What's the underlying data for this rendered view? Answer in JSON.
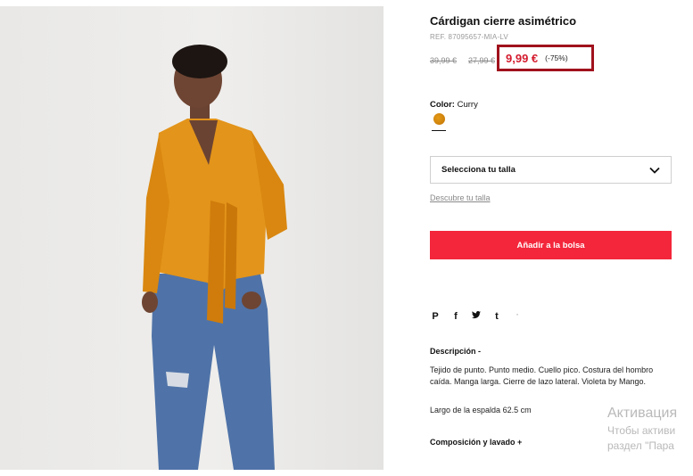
{
  "product": {
    "title": "Cárdigan cierre asimétrico",
    "ref": "REF. 87095657-MIA-LV",
    "old_price_1": "39,99 €",
    "old_price_2": "27,99 €",
    "price": "9,99 €",
    "discount": "(-75%)"
  },
  "color": {
    "label": "Color:",
    "value": "Curry",
    "swatch_hex": "#d98a0f"
  },
  "size": {
    "select_label": "Selecciona tu talla",
    "guide_link": "Descubre tu talla"
  },
  "cart": {
    "add_label": "Añadir a la bolsa"
  },
  "share": {
    "pinterest": "P",
    "facebook": "f",
    "twitter": "t",
    "tumblr": "t",
    "extra": "'"
  },
  "description": {
    "heading": "Descripción  -",
    "text": "Tejido de punto. Punto medio. Cuello pico. Costura del hombro caída. Manga larga. Cierre de lazo lateral. Violeta by Mango.",
    "length": "Largo de la espalda 62.5 cm"
  },
  "composition": {
    "heading": "Composición y lavado  +"
  },
  "activation_overlay": {
    "line1": "Активация",
    "line2": "Чтобы активи",
    "line3": "раздел \"Пара"
  },
  "colors": {
    "accent_red": "#f3263b",
    "price_red": "#d41c2e",
    "highlight_border": "#a0121c"
  }
}
